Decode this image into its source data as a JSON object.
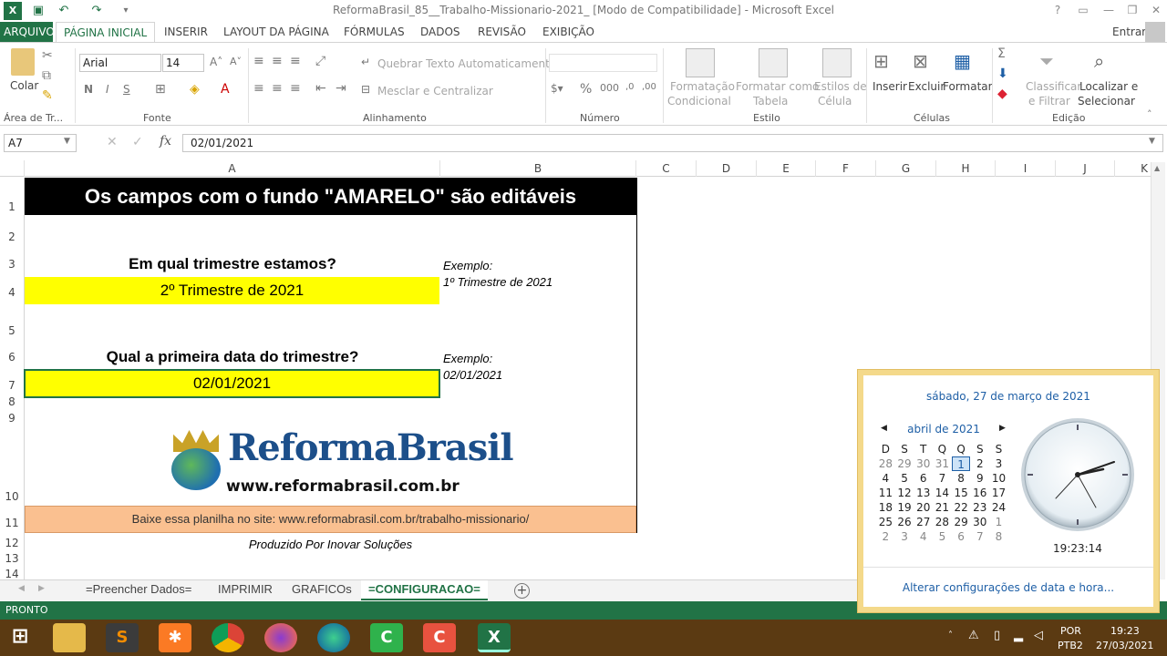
{
  "window": {
    "title": "ReformaBrasil_85__Trabalho-Missionario-2021_  [Modo de Compatibilidade] - Microsoft Excel",
    "help": "?",
    "minimize": "—",
    "restore": "❐",
    "close": "✕"
  },
  "ribbon_tabs": {
    "file": "ARQUIVO",
    "home": "PÁGINA INICIAL",
    "insert": "INSERIR",
    "layout": "LAYOUT DA PÁGINA",
    "formulas": "FÓRMULAS",
    "data": "DADOS",
    "review": "REVISÃO",
    "view": "EXIBIÇÃO",
    "signin": "Entrar"
  },
  "ribbon": {
    "paste": "Colar",
    "font_name": "Arial",
    "font_size": "14",
    "bold": "N",
    "italic": "I",
    "underline": "S",
    "wrap_text": "Quebrar Texto Automaticamente",
    "merge_center": "Mesclar e Centralizar",
    "cond_format_1": "Formatação",
    "cond_format_2": "Condicional",
    "format_table_1": "Formatar como",
    "format_table_2": "Tabela",
    "cell_styles_1": "Estilos de",
    "cell_styles_2": "Célula",
    "insert": "Inserir",
    "delete": "Excluir",
    "format": "Formatar",
    "sort_1": "Classificar",
    "sort_2": "e Filtrar",
    "find_1": "Localizar e",
    "find_2": "Selecionar",
    "groups": {
      "clipboard": "Área de Tr...",
      "font": "Fonte",
      "alignment": "Alinhamento",
      "number": "Número",
      "styles": "Estilo",
      "cells": "Células",
      "editing": "Edição"
    }
  },
  "formula_bar": {
    "name_box": "A7",
    "fx": "fx",
    "value": "02/01/2021"
  },
  "columns": [
    "A",
    "B",
    "C",
    "D",
    "E",
    "F",
    "G",
    "H",
    "I",
    "J",
    "K"
  ],
  "rows": [
    "1",
    "2",
    "3",
    "4",
    "5",
    "6",
    "7",
    "8",
    "9",
    "10",
    "11",
    "12",
    "13",
    "14"
  ],
  "sheet": {
    "title": "Os campos com o fundo \"AMARELO\" são editáveis",
    "q1": "Em qual trimestre estamos?",
    "a1": "2º Trimestre de 2021",
    "ex1_label": "Exemplo:",
    "ex1_value": "1º Trimestre de 2021",
    "q2": "Qual a primeira data do trimestre?",
    "a2": "02/01/2021",
    "ex2_label": "Exemplo:",
    "ex2_value": "02/01/2021",
    "logo_text": "ReformaBrasil",
    "logo_url": "www.reformabrasil.com.br",
    "download": "Baixe essa planilha no site: www.reformabrasil.com.br/trabalho-missionario/",
    "credit": "Produzido Por Inovar Soluções"
  },
  "sheet_tabs": [
    "=Preencher Dados=",
    "IMPRIMIR",
    "GRAFICOs",
    "=CONFIGURACAO="
  ],
  "status": "PRONTO",
  "calendar": {
    "full_date": "sábado, 27 de março de 2021",
    "month": "abril de 2021",
    "weekdays": [
      "D",
      "S",
      "T",
      "Q",
      "Q",
      "S",
      "S"
    ],
    "weeks": [
      [
        "28",
        "29",
        "30",
        "31",
        "1",
        "2",
        "3"
      ],
      [
        "4",
        "5",
        "6",
        "7",
        "8",
        "9",
        "10"
      ],
      [
        "11",
        "12",
        "13",
        "14",
        "15",
        "16",
        "17"
      ],
      [
        "18",
        "19",
        "20",
        "21",
        "22",
        "23",
        "24"
      ],
      [
        "25",
        "26",
        "27",
        "28",
        "29",
        "30",
        "1"
      ],
      [
        "2",
        "3",
        "4",
        "5",
        "6",
        "7",
        "8"
      ]
    ],
    "time": "19:23:14",
    "settings_link": "Alterar configurações de data e hora..."
  },
  "tray": {
    "lang_1": "POR",
    "lang_2": "PTB2",
    "time": "19:23",
    "date": "27/03/2021"
  },
  "colors": {
    "excel_green": "#217346",
    "highlight_yellow": "#ffff00",
    "band_orange": "#fac090",
    "taskbar": "#5b3a12"
  }
}
